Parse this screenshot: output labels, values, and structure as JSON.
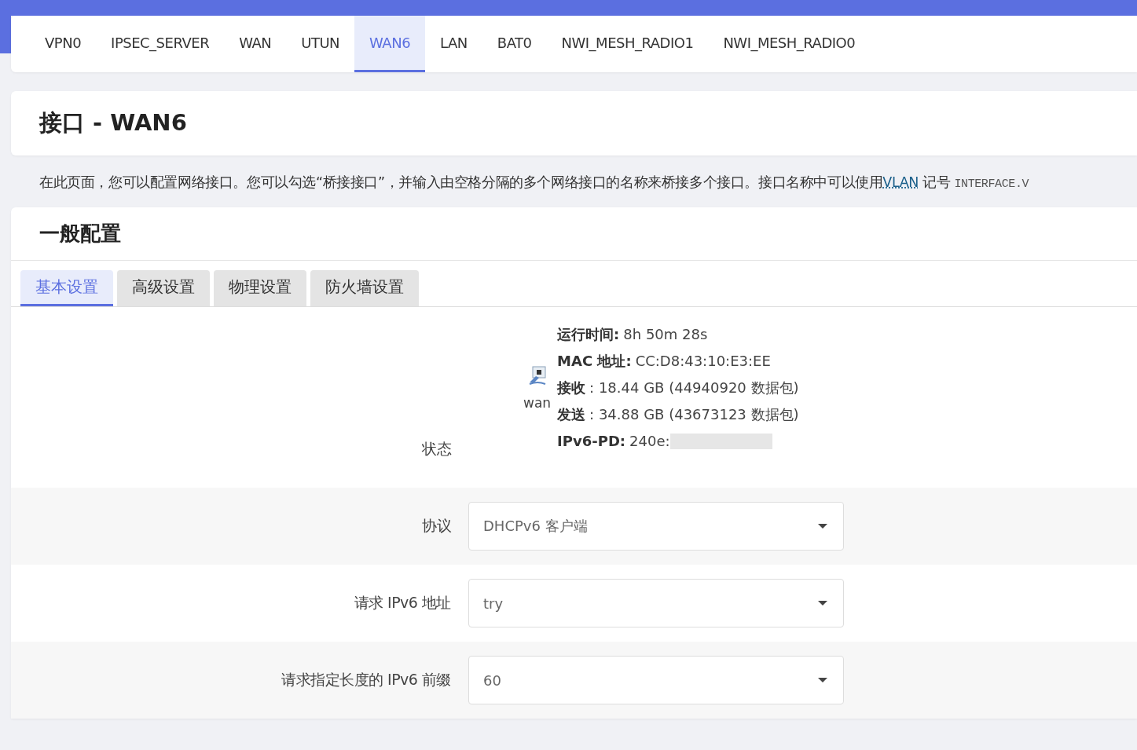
{
  "tabs": [
    {
      "label": "VPN0",
      "selected": false
    },
    {
      "label": "IPSEC_SERVER",
      "selected": false
    },
    {
      "label": "WAN",
      "selected": false
    },
    {
      "label": "UTUN",
      "selected": false
    },
    {
      "label": "WAN6",
      "selected": true
    },
    {
      "label": "LAN",
      "selected": false
    },
    {
      "label": "BAT0",
      "selected": false
    },
    {
      "label": "NWI_MESH_RADIO1",
      "selected": false
    },
    {
      "label": "NWI_MESH_RADIO0",
      "selected": false
    }
  ],
  "page_title": "接口 - WAN6",
  "description": {
    "text": "在此页面，您可以配置网络接口。您可以勾选“桥接接口”，并输入由空格分隔的多个网络接口的名称来桥接多个接口。接口名称中可以使用",
    "link": "VLAN",
    "after": "记号",
    "code": "INTERFACE.V"
  },
  "section_title": "一般配置",
  "subtabs": [
    {
      "label": "基本设置",
      "selected": true
    },
    {
      "label": "高级设置",
      "selected": false
    },
    {
      "label": "物理设置",
      "selected": false
    },
    {
      "label": "防火墙设置",
      "selected": false
    }
  ],
  "status": {
    "label": "状态",
    "device": "wan",
    "lines": [
      {
        "key": "运行时间:",
        "value": "8h 50m 28s"
      },
      {
        "key": "MAC 地址:",
        "value": "CC:D8:43:10:E3:EE"
      },
      {
        "key": "接收",
        "value": ": 18.44 GB (44940920 数据包)"
      },
      {
        "key": "发送",
        "value": ": 34.88 GB (43673123 数据包)"
      },
      {
        "key": "IPv6-PD:",
        "value": "240e:",
        "redacted": true
      }
    ]
  },
  "fields": [
    {
      "label": "协议",
      "value": "DHCPv6 客户端"
    },
    {
      "label": "请求 IPv6 地址",
      "value": "try"
    },
    {
      "label": "请求指定长度的 IPv6 前缀",
      "value": "60"
    }
  ]
}
